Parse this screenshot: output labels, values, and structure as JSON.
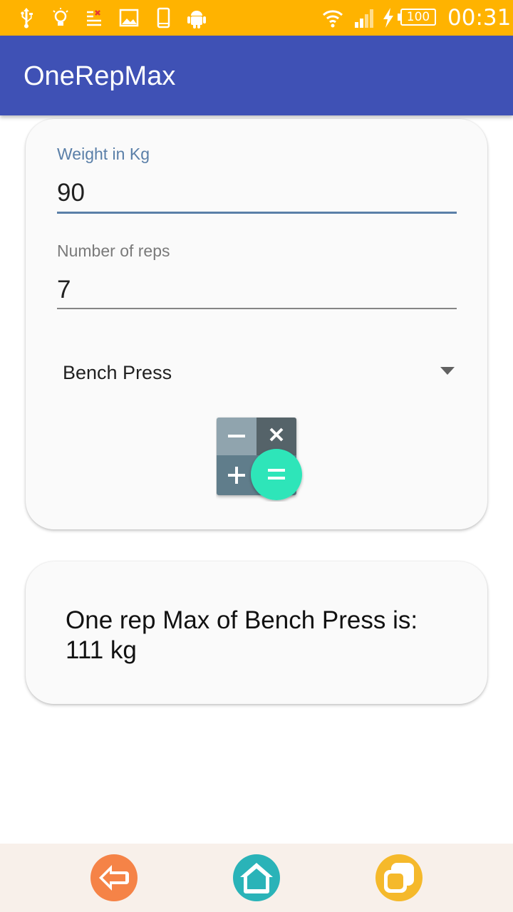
{
  "status_bar": {
    "icons": [
      "usb-icon",
      "lightbulb-icon",
      "notification-list-icon",
      "image-icon",
      "phone-icon",
      "android-icon",
      "wifi-icon",
      "signal-icon",
      "charging-icon"
    ],
    "battery_level": "100",
    "time": "00:31",
    "background_color": "#ffb300"
  },
  "app_bar": {
    "title": "OneRepMax",
    "color": "#3f51b5"
  },
  "form": {
    "weight": {
      "label": "Weight in Kg",
      "value": "90"
    },
    "reps": {
      "label": "Number of reps",
      "value": "7"
    },
    "exercise": {
      "selected": "Bench Press"
    },
    "calculate_icon": "calculator-icon"
  },
  "result": {
    "line1": "One rep Max of Bench Press is:",
    "line2": "111 kg"
  },
  "nav_bar": {
    "back_icon": "back-arrow-icon",
    "home_icon": "home-icon",
    "recents_icon": "recents-icon",
    "back_color": "#f58347",
    "home_color": "#2ab3b8",
    "recents_color": "#f5b92b"
  }
}
